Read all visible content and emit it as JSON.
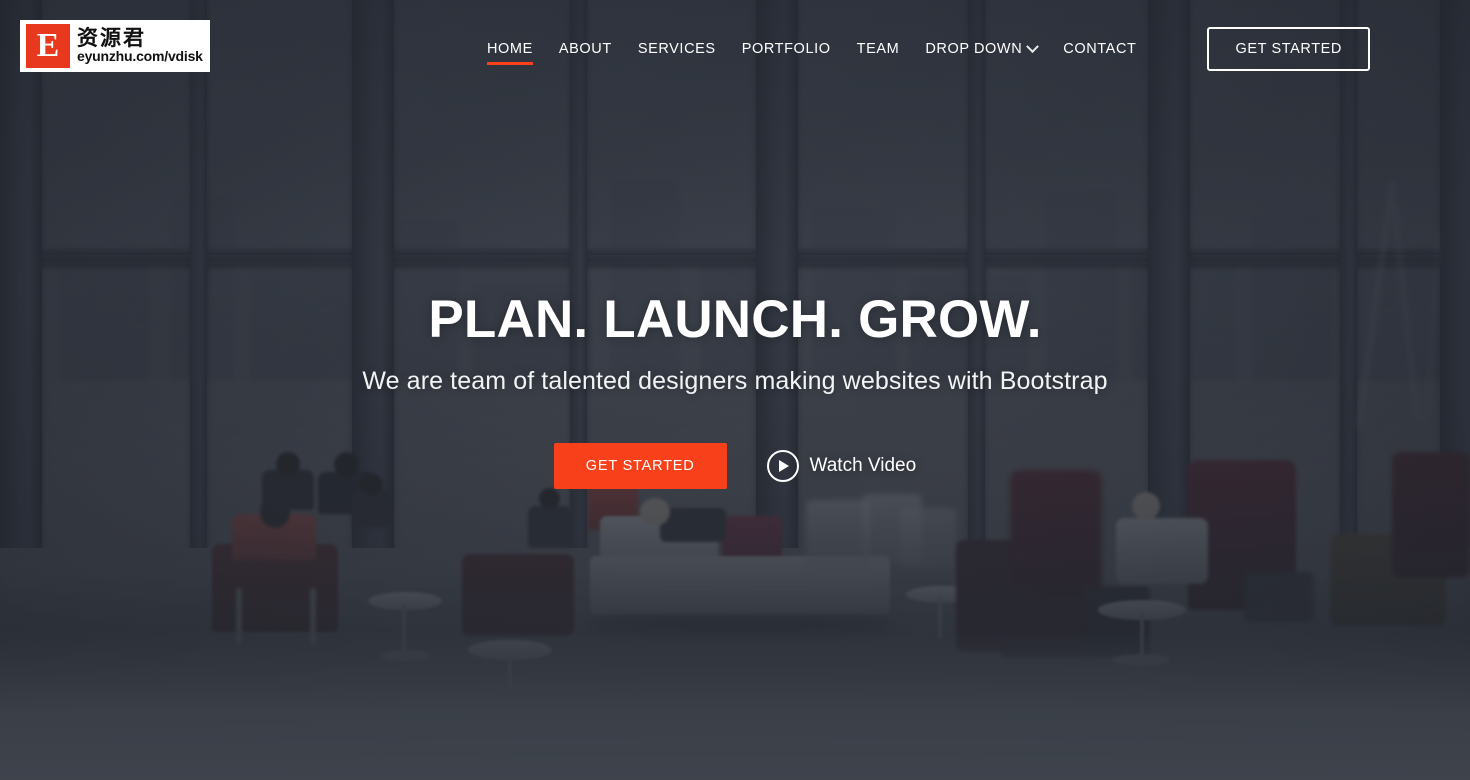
{
  "watermark": {
    "mark_letter": "E",
    "cn_text": "资源君",
    "url_text": "eyunzhu.com/vdisk"
  },
  "nav": {
    "items": [
      {
        "label": "HOME",
        "active": true,
        "has_caret": false
      },
      {
        "label": "ABOUT",
        "active": false,
        "has_caret": false
      },
      {
        "label": "SERVICES",
        "active": false,
        "has_caret": false
      },
      {
        "label": "PORTFOLIO",
        "active": false,
        "has_caret": false
      },
      {
        "label": "TEAM",
        "active": false,
        "has_caret": false
      },
      {
        "label": "DROP DOWN",
        "active": false,
        "has_caret": true
      },
      {
        "label": "CONTACT",
        "active": false,
        "has_caret": false
      }
    ],
    "cta_label": "GET STARTED"
  },
  "hero": {
    "title": "PLAN. LAUNCH. GROW.",
    "subtitle": "We are team of talented designers making websites with Bootstrap",
    "primary_button": "GET STARTED",
    "video_label": "Watch Video"
  },
  "colors": {
    "accent_orange": "#f8401b",
    "watermark_red": "#e8391f",
    "page_bottom": "#3e434c",
    "text_light": "#ffffff"
  }
}
